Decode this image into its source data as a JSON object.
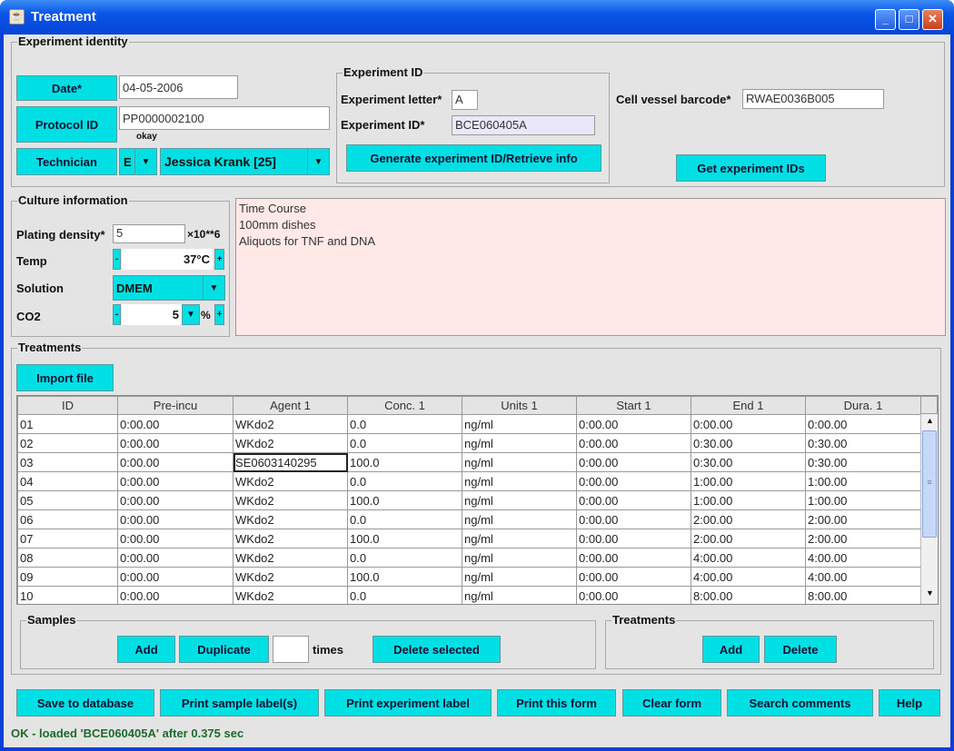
{
  "window": {
    "title": "Treatment",
    "minimize": "_",
    "maximize": "□",
    "close": "✕"
  },
  "identity": {
    "legend": "Experiment identity",
    "date_label": "Date*",
    "date_value": "04-05-2006",
    "protocol_label": "Protocol ID",
    "protocol_value": "PP0000002100",
    "protocol_status": "okay",
    "technician_label": "Technician",
    "technician_initial": "E",
    "technician_name": "Jessica Krank [25]",
    "expid": {
      "legend": "Experiment ID",
      "letter_label": "Experiment letter*",
      "letter_value": "A",
      "id_label": "Experiment ID*",
      "id_value": "BCE060405A",
      "generate_button": "Generate experiment ID/Retrieve info"
    },
    "barcode_label": "Cell vessel barcode*",
    "barcode_value": "RWAE0036B005",
    "get_ids_button": "Get experiment IDs"
  },
  "culture": {
    "legend": "Culture information",
    "plating_label": "Plating density*",
    "plating_value": "5",
    "plating_unit": "×10**6",
    "temp_label": "Temp",
    "temp_value": "37°C",
    "solution_label": "Solution",
    "solution_value": "DMEM",
    "co2_label": "CO2",
    "co2_value": "5",
    "co2_unit": "%",
    "minus": "-",
    "plus": "+"
  },
  "notes": [
    "Time Course",
    "100mm dishes",
    "Aliquots for TNF and DNA"
  ],
  "treatments": {
    "legend": "Treatments",
    "import_button": "Import file",
    "columns": [
      "ID",
      "Pre-incu",
      "Agent 1",
      "Conc. 1",
      "Units 1",
      "Start 1",
      "End 1",
      "Dura. 1"
    ],
    "rows": [
      [
        "01",
        "0:00.00",
        "WKdo2",
        "0.0",
        "ng/ml",
        "0:00.00",
        "0:00.00",
        "0:00.00"
      ],
      [
        "02",
        "0:00.00",
        "WKdo2",
        "0.0",
        "ng/ml",
        "0:00.00",
        "0:30.00",
        "0:30.00"
      ],
      [
        "03",
        "0:00.00",
        "SE0603140295",
        "100.0",
        "ng/ml",
        "0:00.00",
        "0:30.00",
        "0:30.00"
      ],
      [
        "04",
        "0:00.00",
        "WKdo2",
        "0.0",
        "ng/ml",
        "0:00.00",
        "1:00.00",
        "1:00.00"
      ],
      [
        "05",
        "0:00.00",
        "WKdo2",
        "100.0",
        "ng/ml",
        "0:00.00",
        "1:00.00",
        "1:00.00"
      ],
      [
        "06",
        "0:00.00",
        "WKdo2",
        "0.0",
        "ng/ml",
        "0:00.00",
        "2:00.00",
        "2:00.00"
      ],
      [
        "07",
        "0:00.00",
        "WKdo2",
        "100.0",
        "ng/ml",
        "0:00.00",
        "2:00.00",
        "2:00.00"
      ],
      [
        "08",
        "0:00.00",
        "WKdo2",
        "0.0",
        "ng/ml",
        "0:00.00",
        "4:00.00",
        "4:00.00"
      ],
      [
        "09",
        "0:00.00",
        "WKdo2",
        "100.0",
        "ng/ml",
        "0:00.00",
        "4:00.00",
        "4:00.00"
      ],
      [
        "10",
        "0:00.00",
        "WKdo2",
        "0.0",
        "ng/ml",
        "0:00.00",
        "8:00.00",
        "8:00.00"
      ]
    ],
    "samples": {
      "legend": "Samples",
      "add": "Add",
      "duplicate": "Duplicate",
      "times_value": "",
      "times_label": "times",
      "delete_selected": "Delete selected"
    },
    "treat_box": {
      "legend": "Treatments",
      "add": "Add",
      "delete": "Delete"
    }
  },
  "footer": {
    "buttons": [
      "Save to database",
      "Print sample label(s)",
      "Print experiment label",
      "Print this form",
      "Clear form",
      "Search comments",
      "Help"
    ],
    "status": "OK - loaded 'BCE060405A' after 0.375 sec"
  },
  "colors": {
    "button": "#00e0e4",
    "status": "#1c6b2a",
    "notes_bg": "#ffe9e7"
  }
}
